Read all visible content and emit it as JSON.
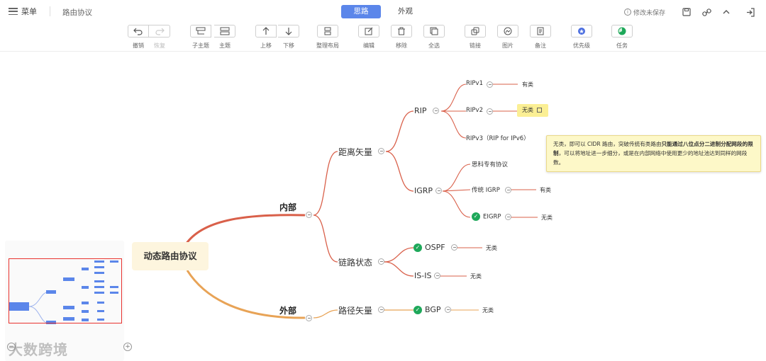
{
  "header": {
    "menu_label": "菜单",
    "doc_name": "路由协议",
    "tabs": [
      "思路",
      "外观"
    ],
    "unsaved_label": "修改未保存"
  },
  "toolbar": {
    "undo": "撤销",
    "redo": "恢复",
    "subtopic": "子主题",
    "topic": "主题",
    "move_up": "上移",
    "move_down": "下移",
    "layout": "整理布局",
    "edit": "编辑",
    "remove": "移除",
    "select_all": "全选",
    "link": "链接",
    "image": "图片",
    "note": "备注",
    "priority": "优先级",
    "task": "任务"
  },
  "mindmap": {
    "root": "动态路由协议",
    "internal": "内部",
    "external": "外部",
    "distance_vector": "距离矢量",
    "link_state": "链路状态",
    "path_vector": "路径矢量",
    "rip": "RIP",
    "igrp": "IGRP",
    "ripv1": "RIPv1",
    "ripv2": "RIPv2",
    "ripv3": "RIPv3（RIP for IPv6）",
    "cisco_proprietary": "思科专有协议",
    "traditional_igrp": "传统 IGRP",
    "eigrp": "EIGRP",
    "ospf": "OSPF",
    "isis": "IS-IS",
    "bgp": "BGP",
    "classful": "有类",
    "classless": "无类"
  },
  "tooltip": {
    "part1": "无类，即可以 CIDR 路由，突破传统有类路由",
    "bold": "只能通过八位点分二进制分配网段的限制",
    "part2": "，可以将地址进一步细分，或是在内部网络中使用更少的地址池达到同样的网段数。"
  },
  "colors": {
    "accent": "#5b86ea",
    "branch_internal": "#d9604a",
    "branch_external": "#e8a356",
    "root_bg": "#fdf5de",
    "highlight": "#fbef94",
    "check": "#1ea85a"
  },
  "watermark": "大数跨境"
}
